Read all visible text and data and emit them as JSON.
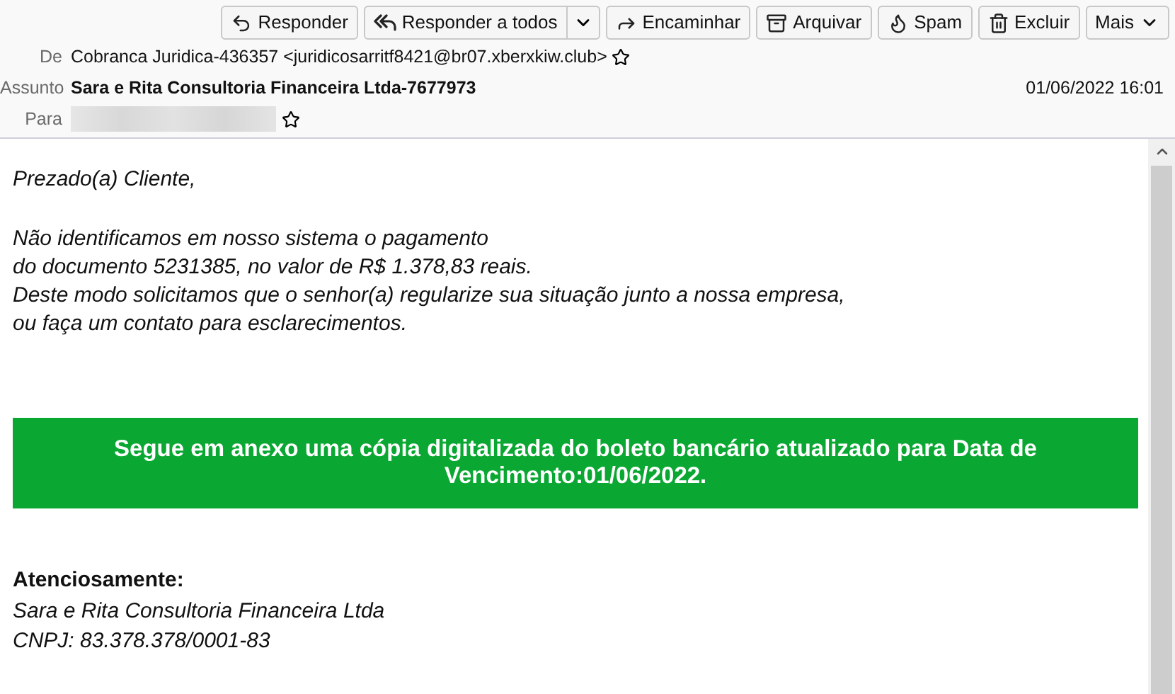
{
  "toolbar": {
    "buttons": [
      {
        "kind": "reply",
        "label": "Responder"
      },
      {
        "kind": "reply-all",
        "label": "Responder a todos"
      },
      {
        "kind": "forward",
        "label": "Encaminhar"
      },
      {
        "kind": "archive",
        "label": "Arquivar"
      },
      {
        "kind": "spam",
        "label": "Spam"
      },
      {
        "kind": "delete",
        "label": "Excluir"
      },
      {
        "kind": "more",
        "label": "Mais"
      }
    ]
  },
  "header": {
    "from": {
      "label": "De",
      "value": "Cobranca Juridica-436357 <juridicosarritf8421@br07.xberxkiw.club>"
    },
    "subject": {
      "label": "Assunto",
      "value": "Sara e Rita Consultoria Financeira Ltda-7677973"
    },
    "date": "01/06/2022 16:01",
    "to": {
      "label": "Para"
    }
  },
  "body": {
    "greeting": "Prezado(a) Cliente,",
    "paragraph": [
      "Não identificamos em nosso sistema o pagamento",
      "do documento 5231385, no valor de R$ 1.378,83 reais.",
      "Deste modo solicitamos que o senhor(a) regularize sua situação junto a nossa empresa,",
      "ou faça um contato para esclarecimentos."
    ],
    "banner": "Segue em anexo uma cópia digitalizada do boleto bancário atualizado para Data de Vencimento:01/06/2022.",
    "closing": "Atenciosamente:",
    "signature": [
      "Sara e Rita Consultoria Financeira Ltda",
      "CNPJ: 83.378.378/0001-83"
    ]
  }
}
